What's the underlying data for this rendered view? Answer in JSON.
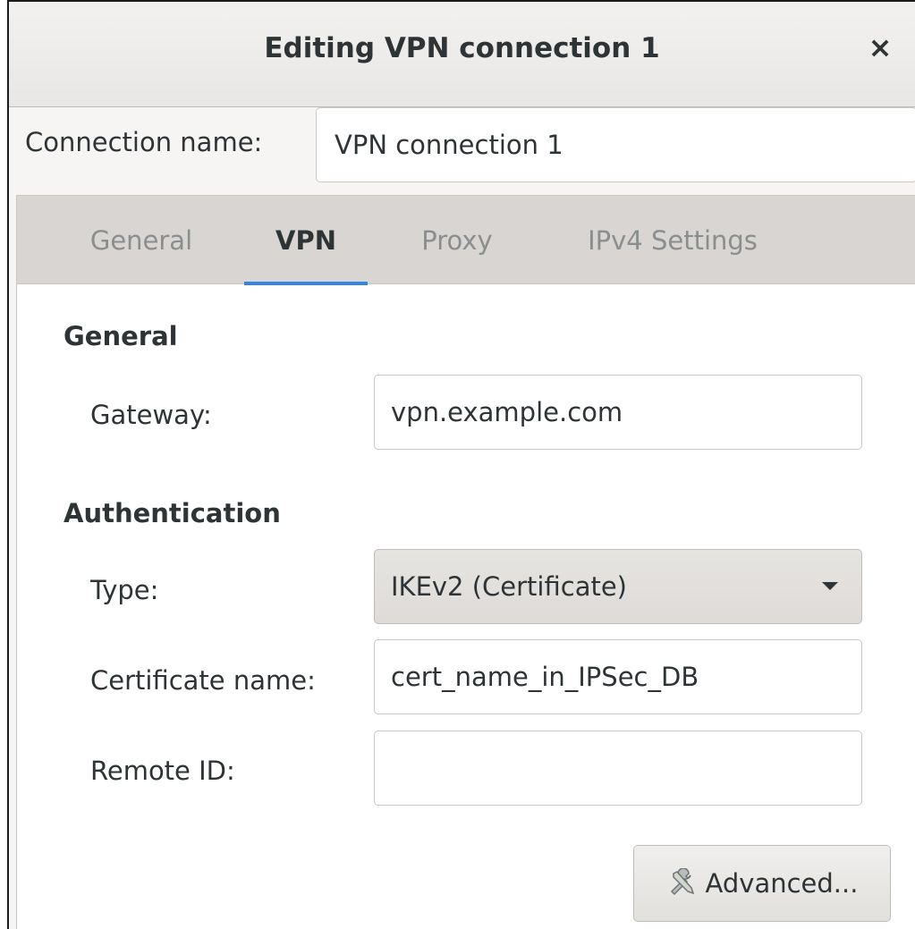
{
  "window": {
    "title": "Editing VPN connection 1",
    "close_glyph": "×"
  },
  "connection": {
    "label": "Connection name:",
    "value": "VPN connection 1"
  },
  "tabs": [
    {
      "label": "General",
      "active": false
    },
    {
      "label": "VPN",
      "active": true
    },
    {
      "label": "Proxy",
      "active": false
    },
    {
      "label": "IPv4 Settings",
      "active": false
    }
  ],
  "general": {
    "heading": "General",
    "gateway_label": "Gateway:",
    "gateway_value": "vpn.example.com"
  },
  "auth": {
    "heading": "Authentication",
    "type_label": "Type:",
    "type_value": "IKEv2 (Certificate)",
    "cert_label": "Certificate name:",
    "cert_value": "cert_name_in_IPSec_DB",
    "remote_label": "Remote ID:",
    "remote_value": ""
  },
  "advanced_button": {
    "label": "Advanced...",
    "icon": "tools-icon"
  },
  "colors": {
    "accent": "#3584e4",
    "tab_inactive": "#8b8e8f",
    "text": "#2e3436"
  }
}
